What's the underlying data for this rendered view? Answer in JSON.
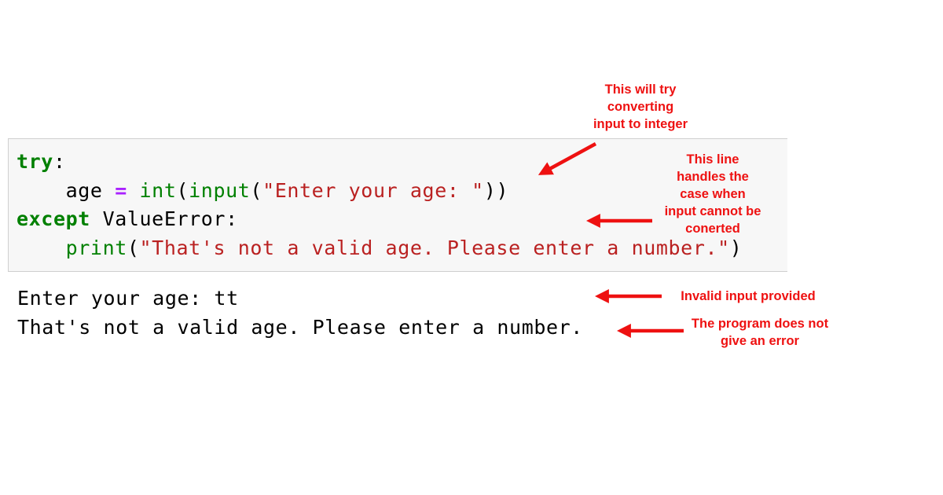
{
  "code_cell": {
    "lines": [
      [
        {
          "t": "try",
          "k": "kw"
        },
        {
          "t": ":",
          "k": "plain"
        }
      ],
      [
        {
          "t": "    age ",
          "k": "plain"
        },
        {
          "t": "=",
          "k": "op"
        },
        {
          "t": " ",
          "k": "plain"
        },
        {
          "t": "int",
          "k": "bi"
        },
        {
          "t": "(",
          "k": "plain"
        },
        {
          "t": "input",
          "k": "bi"
        },
        {
          "t": "(",
          "k": "plain"
        },
        {
          "t": "\"Enter your age: \"",
          "k": "str"
        },
        {
          "t": "))",
          "k": "plain"
        }
      ],
      [
        {
          "t": "except",
          "k": "kw"
        },
        {
          "t": " ValueError:",
          "k": "plain"
        }
      ],
      [
        {
          "t": "    ",
          "k": "plain"
        },
        {
          "t": "print",
          "k": "bi"
        },
        {
          "t": "(",
          "k": "plain"
        },
        {
          "t": "\"That's not a valid age. Please enter a number.\"",
          "k": "str"
        },
        {
          "t": ")",
          "k": "plain"
        }
      ]
    ]
  },
  "output": {
    "lines": [
      "Enter your age: tt",
      "That's not a valid age. Please enter a number."
    ]
  },
  "annotations": {
    "try_convert": [
      "This will try",
      "converting",
      "input to integer"
    ],
    "except_handler": [
      "This line",
      "handles the",
      "case when",
      "input cannot be",
      "conerted"
    ],
    "invalid_input": [
      "Invalid input provided"
    ],
    "no_error": [
      "The program does not",
      "give an error"
    ]
  },
  "colors": {
    "annotation": "#ee1111",
    "keyword": "#008000",
    "string": "#ba2121",
    "operator": "#aa22ff",
    "cell_background": "#f7f7f7"
  }
}
